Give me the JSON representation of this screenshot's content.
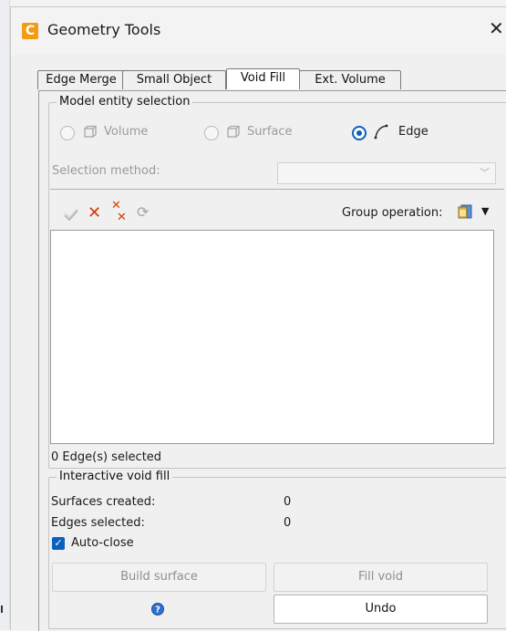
{
  "window": {
    "title": "Geometry Tools"
  },
  "tabs": [
    {
      "label": "Edge Merge"
    },
    {
      "label": "Small Object"
    },
    {
      "label": "Void Fill"
    },
    {
      "label": "Ext. Volume"
    }
  ],
  "active_tab": "Void Fill",
  "model_entity_selection": {
    "legend": "Model entity selection",
    "options": [
      {
        "label": "Volume",
        "checked": false,
        "enabled": false
      },
      {
        "label": "Surface",
        "checked": false,
        "enabled": false
      },
      {
        "label": "Edge",
        "checked": true,
        "enabled": true
      }
    ],
    "selection_method_label": "Selection method:",
    "selection_method_value": "",
    "group_operation_label": "Group operation:",
    "status": "0 Edge(s) selected"
  },
  "interactive_void_fill": {
    "legend": "Interactive void fill",
    "surfaces_created_label": "Surfaces created:",
    "surfaces_created_value": "0",
    "edges_selected_label": "Edges selected:",
    "edges_selected_value": "0",
    "auto_close_label": "Auto-close",
    "auto_close_checked": true,
    "build_surface_label": "Build surface",
    "fill_void_label": "Fill void",
    "undo_label": "Undo"
  },
  "colors": {
    "accent": "#0b5fbf",
    "app_icon": "#f39b13",
    "delete": "#d83b01"
  }
}
